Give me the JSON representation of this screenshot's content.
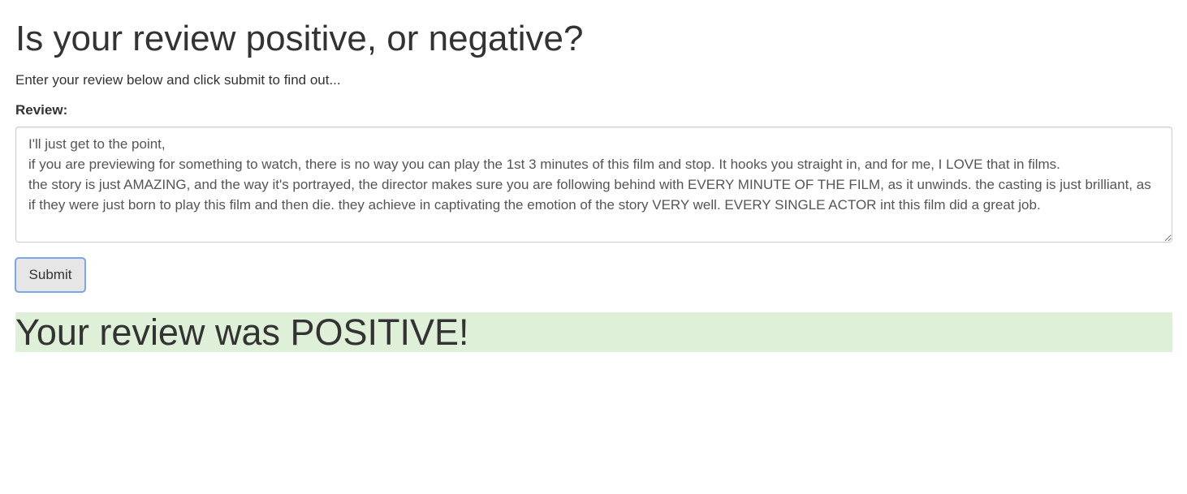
{
  "page": {
    "title": "Is your review positive, or negative?",
    "instructions": "Enter your review below and click submit to find out..."
  },
  "form": {
    "review_label": "Review:",
    "review_value": "I'll just get to the point,\nif you are previewing for something to watch, there is no way you can play the 1st 3 minutes of this film and stop. It hooks you straight in, and for me, I LOVE that in films.\nthe story is just AMAZING, and the way it's portrayed, the director makes sure you are following behind with EVERY MINUTE OF THE FILM, as it unwinds. the casting is just brilliant, as if they were just born to play this film and then die. they achieve in captivating the emotion of the story VERY well. EVERY SINGLE ACTOR int this film did a great job.",
    "submit_label": "Submit"
  },
  "result": {
    "text": "Your review was POSITIVE!",
    "background_color": "#dff0d8"
  }
}
